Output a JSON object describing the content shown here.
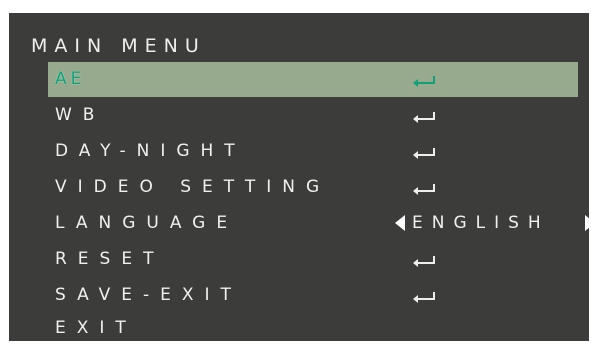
{
  "menu": {
    "title": "MAIN MENU",
    "items": [
      {
        "label": "AE",
        "selected": true,
        "action_icon": "enter-return-icon"
      },
      {
        "label": "WB",
        "selected": false,
        "action_icon": "enter-return-icon"
      },
      {
        "label": "DAY-NIGHT",
        "selected": false,
        "action_icon": "enter-return-icon"
      },
      {
        "label": "VIDEO SETTING",
        "selected": false,
        "action_icon": "enter-return-icon"
      },
      {
        "label": "LANGUAGE",
        "selected": false,
        "value": "ENGLISH",
        "action_icons": [
          "left-arrow-icon",
          "right-arrow-icon"
        ]
      },
      {
        "label": "RESET",
        "selected": false,
        "action_icon": "enter-return-icon"
      },
      {
        "label": "SAVE-EXIT",
        "selected": false,
        "action_icon": "enter-return-icon"
      },
      {
        "label": "EXIT",
        "selected": false
      }
    ]
  },
  "colors": {
    "background": "#3c3c3a",
    "selection": "#97aa8d",
    "selected_text": "#0f9f7a",
    "text": "#f0f0ec"
  }
}
